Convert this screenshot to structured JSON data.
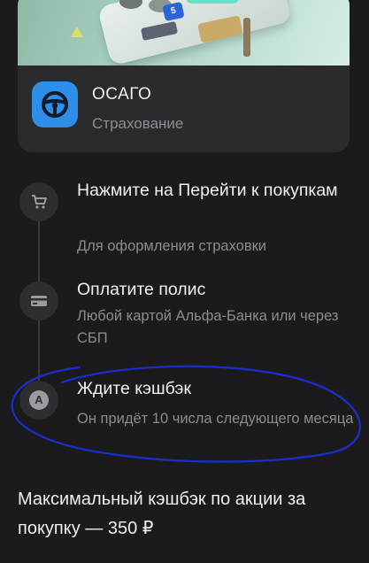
{
  "card": {
    "title": "ОСАГО",
    "subtitle": "Страхование",
    "banner_badge": "5"
  },
  "steps": [
    {
      "icon": "cart-icon",
      "title": "Нажмите на Перейти к покупкам",
      "description": "Для оформления страховки"
    },
    {
      "icon": "card-icon",
      "title": "Оплатите полис",
      "description": "Любой картой Альфа-Банка или через СБП"
    },
    {
      "icon": "alfa-logo-icon",
      "icon_letter": "A",
      "title": "Ждите кэшбэк",
      "description": "Он придёт 10 числа следующего месяца"
    }
  ],
  "max_cashback": "Максимальный кэшбэк по акции за покупку — 350 ₽",
  "colors": {
    "background": "#1b1b1d",
    "card": "#2b2b2e",
    "accent_icon": "#2f8ee8",
    "annotation_ink": "#1a2ed0"
  }
}
